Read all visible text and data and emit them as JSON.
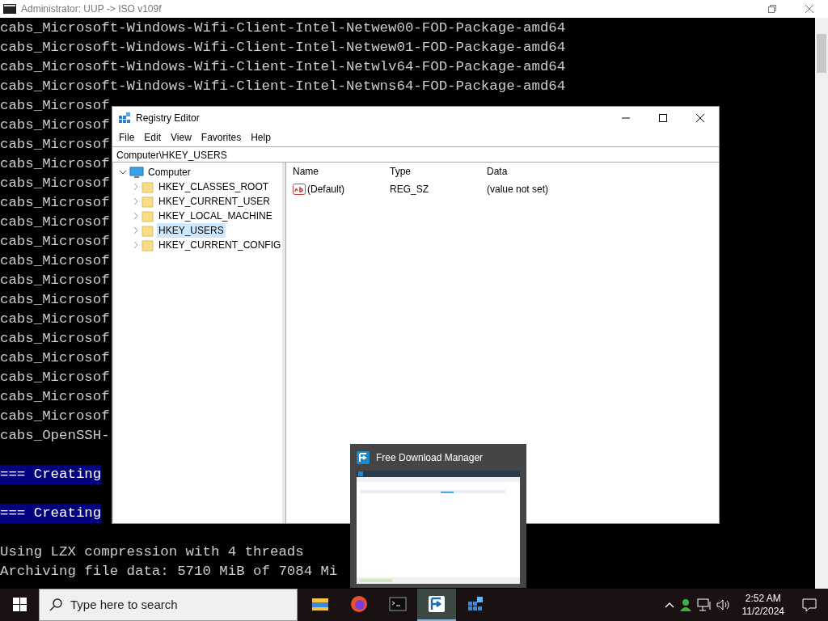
{
  "console": {
    "title": "Administrator:  UUP -> ISO v109f",
    "lines": [
      {
        "text": "cabs_Microsoft-Windows-Wifi-Client-Intel-Netwew00-FOD-Package-amd64",
        "highlighted": false,
        "gap_before": false
      },
      {
        "text": "cabs_Microsoft-Windows-Wifi-Client-Intel-Netwew01-FOD-Package-amd64",
        "highlighted": false,
        "gap_before": false
      },
      {
        "text": "cabs_Microsoft-Windows-Wifi-Client-Intel-Netwlv64-FOD-Package-amd64",
        "highlighted": false,
        "gap_before": false
      },
      {
        "text": "cabs_Microsoft-Windows-Wifi-Client-Intel-Netwns64-FOD-Package-amd64",
        "highlighted": false,
        "gap_before": false
      },
      {
        "text": "cabs_Microsof",
        "highlighted": false,
        "gap_before": false
      },
      {
        "text": "cabs_Microsof",
        "highlighted": false,
        "gap_before": false
      },
      {
        "text": "cabs_Microsof",
        "highlighted": false,
        "gap_before": false
      },
      {
        "text": "cabs_Microsof",
        "highlighted": false,
        "gap_before": false
      },
      {
        "text": "cabs_Microsof",
        "highlighted": false,
        "gap_before": false
      },
      {
        "text": "cabs_Microsof",
        "highlighted": false,
        "gap_before": false
      },
      {
        "text": "cabs_Microsof",
        "highlighted": false,
        "gap_before": false
      },
      {
        "text": "cabs_Microsof",
        "highlighted": false,
        "gap_before": false
      },
      {
        "text": "cabs_Microsof",
        "highlighted": false,
        "gap_before": false
      },
      {
        "text": "cabs_Microsof",
        "highlighted": false,
        "gap_before": false
      },
      {
        "text": "cabs_Microsof",
        "highlighted": false,
        "gap_before": false
      },
      {
        "text": "cabs_Microsof",
        "highlighted": false,
        "gap_before": false
      },
      {
        "text": "cabs_Microsof",
        "highlighted": false,
        "gap_before": false
      },
      {
        "text": "cabs_Microsof",
        "highlighted": false,
        "gap_before": false
      },
      {
        "text": "cabs_Microsof",
        "highlighted": false,
        "gap_before": false
      },
      {
        "text": "cabs_Microsof",
        "highlighted": false,
        "gap_before": false
      },
      {
        "text": "cabs_Microsof",
        "highlighted": false,
        "gap_before": false
      },
      {
        "text": "cabs_OpenSSH-",
        "highlighted": false,
        "gap_before": false
      },
      {
        "text": "=== Creating",
        "highlighted": true,
        "gap_before": true
      },
      {
        "text": "=== Creating",
        "highlighted": true,
        "gap_before": true
      },
      {
        "text": "Using LZX compression with 4 threads",
        "highlighted": false,
        "gap_before": true
      },
      {
        "text": "Archiving file data: 5710 MiB of 7084 Mi",
        "highlighted": false,
        "gap_before": false
      }
    ]
  },
  "registry_editor": {
    "title": "Registry Editor",
    "menu": [
      "File",
      "Edit",
      "View",
      "Favorites",
      "Help"
    ],
    "address": "Computer\\HKEY_USERS",
    "tree": {
      "label": "Computer",
      "expanded": true,
      "children": [
        {
          "label": "HKEY_CLASSES_ROOT",
          "selected": false,
          "expanded": false
        },
        {
          "label": "HKEY_CURRENT_USER",
          "selected": false,
          "expanded": false
        },
        {
          "label": "HKEY_LOCAL_MACHINE",
          "selected": false,
          "expanded": false
        },
        {
          "label": "HKEY_USERS",
          "selected": true,
          "expanded": false
        },
        {
          "label": "HKEY_CURRENT_CONFIG",
          "selected": false,
          "expanded": false
        }
      ]
    },
    "columns": [
      "Name",
      "Type",
      "Data"
    ],
    "values": [
      {
        "name": "(Default)",
        "type": "REG_SZ",
        "data": "(value not set)"
      }
    ]
  },
  "thumbnail": {
    "title": "Free Download Manager"
  },
  "taskbar": {
    "search_placeholder": "Type here to search",
    "apps": [
      {
        "kind": "folder",
        "active": false
      },
      {
        "kind": "browser",
        "active": false
      },
      {
        "kind": "terminal",
        "active": false
      },
      {
        "kind": "downloader",
        "active": true
      },
      {
        "kind": "registry",
        "active": false
      }
    ],
    "clock": {
      "time": "2:52 AM",
      "date": "11/2/2024"
    }
  }
}
